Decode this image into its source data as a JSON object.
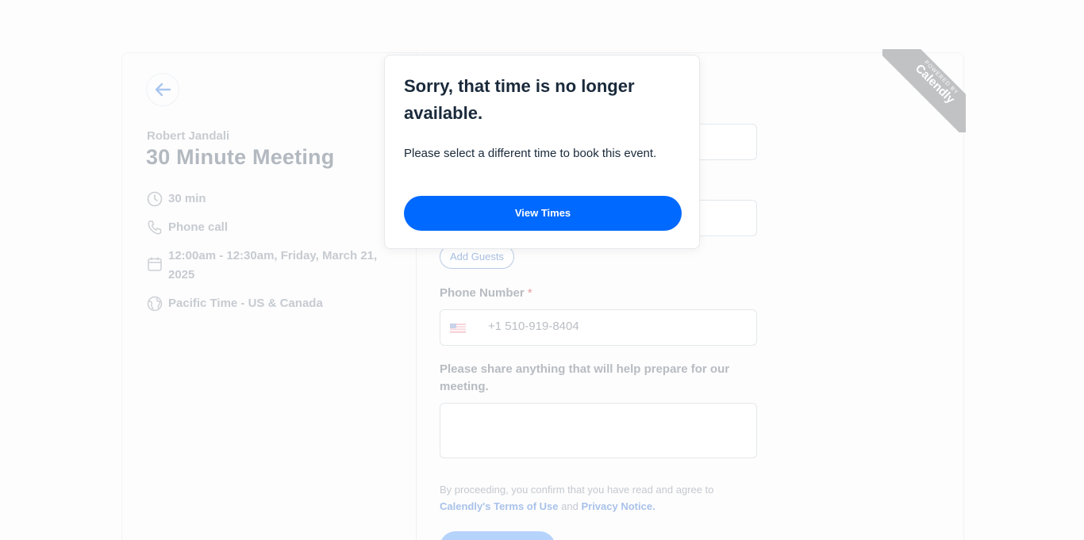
{
  "event": {
    "organizer": "Robert Jandali",
    "title": "30 Minute Meeting",
    "duration": "30 min",
    "location": "Phone call",
    "datetime_line1": "12:00am - 12:30am, Friday, March 21,",
    "datetime_line2": "2025",
    "timezone": "Pacific Time - US & Canada"
  },
  "form": {
    "add_guests_label": "Add Guests",
    "phone_label": "Phone Number",
    "required_mark": "*",
    "phone_value": "+1 510-919-8404",
    "notes_label": "Please share anything that will help prepare for our meeting.",
    "legal_text": "By proceeding, you confirm that you have read and agree to",
    "terms_link": "Calendly's Terms of Use",
    "legal_and": "and",
    "privacy_link": "Privacy Notice."
  },
  "badge": {
    "powered_by": "POWERED BY",
    "brand": "Calendly"
  },
  "modal": {
    "title": "Sorry, that time is no longer available.",
    "body": "Please select a different time to book this event.",
    "button_label": "View Times"
  },
  "colors": {
    "primary": "#0069ff",
    "heading": "#1a2a3b",
    "muted_text": "#b7bcc2"
  }
}
